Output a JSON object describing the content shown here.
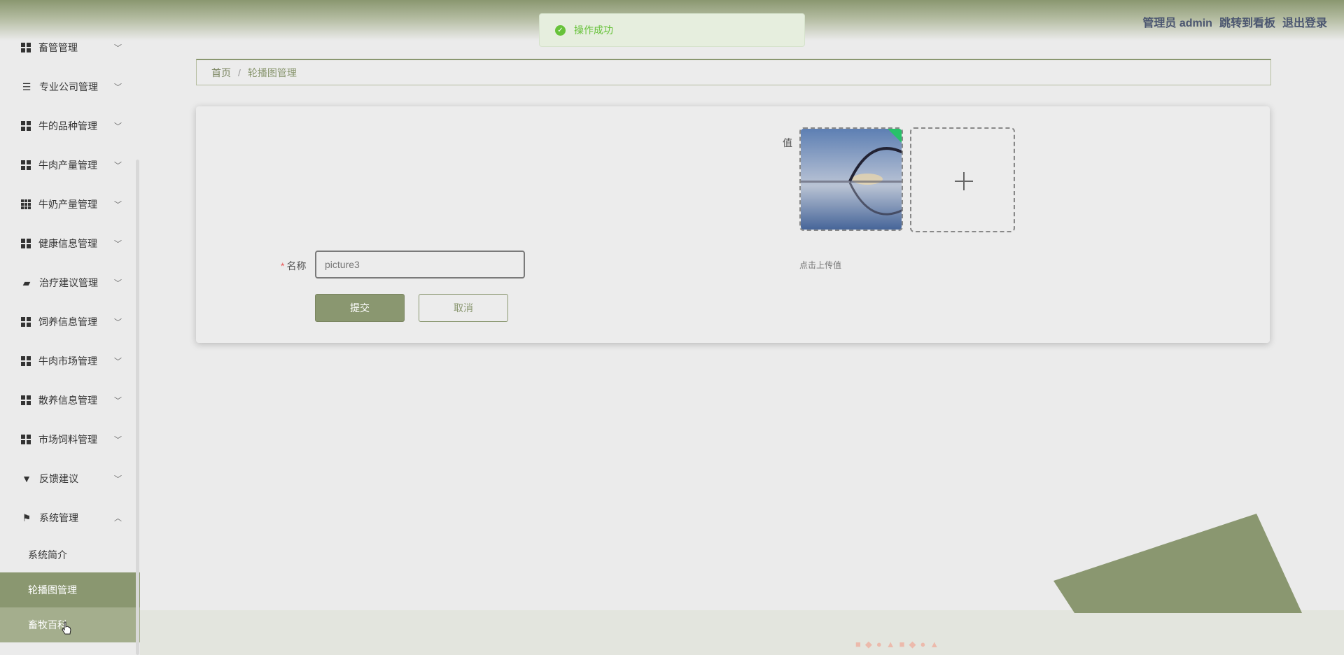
{
  "header": {
    "admin_label": "管理员 admin",
    "dashboard_link": "跳转到看板",
    "logout_link": "退出登录"
  },
  "toast": {
    "message": "操作成功"
  },
  "sidebar": {
    "items": [
      {
        "label": "畜管管理",
        "icon": "grid-icon"
      },
      {
        "label": "专业公司管理",
        "icon": "list-icon"
      },
      {
        "label": "牛的品种管理",
        "icon": "grid-icon"
      },
      {
        "label": "牛肉产量管理",
        "icon": "grid-icon"
      },
      {
        "label": "牛奶产量管理",
        "icon": "grid9-icon"
      },
      {
        "label": "健康信息管理",
        "icon": "grid-icon"
      },
      {
        "label": "治疗建议管理",
        "icon": "briefcase-icon"
      },
      {
        "label": "饲养信息管理",
        "icon": "grid-icon"
      },
      {
        "label": "牛肉市场管理",
        "icon": "grid-icon"
      },
      {
        "label": "散养信息管理",
        "icon": "grid-icon"
      },
      {
        "label": "市场饲料管理",
        "icon": "grid-icon"
      },
      {
        "label": "反馈建议",
        "icon": "brush-icon"
      },
      {
        "label": "系统管理",
        "icon": "flag-icon"
      }
    ],
    "sub_items": [
      {
        "label": "系统简介"
      },
      {
        "label": "轮播图管理"
      },
      {
        "label": "畜牧百科"
      }
    ]
  },
  "breadcrumb": {
    "home": "首页",
    "separator": "/",
    "current": "轮播图管理"
  },
  "form": {
    "value_label": "值",
    "upload_hint": "点击上传值",
    "name_required_mark": "*",
    "name_label": "名称",
    "name_value": "picture3",
    "submit_label": "提交",
    "cancel_label": "取消"
  },
  "colors": {
    "accent": "#8a9770",
    "success": "#67c23a",
    "background": "#ebebeb"
  }
}
